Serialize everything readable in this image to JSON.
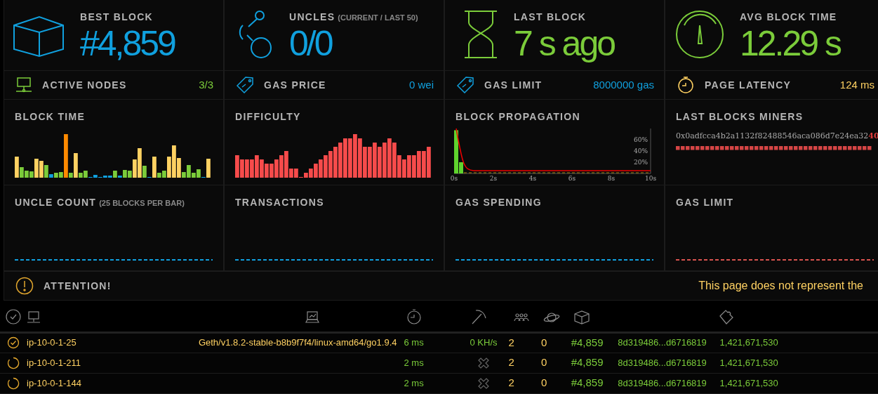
{
  "stats": [
    {
      "kind": "block",
      "label": "BEST BLOCK",
      "value": "#4,859",
      "color": "#10a0de"
    },
    {
      "kind": "uncles",
      "label": "UNCLES",
      "sublabel": "(CURRENT / LAST 50)",
      "value": "0/0",
      "color": "#10a0de"
    },
    {
      "kind": "hourglass",
      "label": "LAST BLOCK",
      "value": "7 s ago",
      "color": "#7bcc3a"
    },
    {
      "kind": "gauge",
      "label": "AVG BLOCK TIME",
      "value": "12.29 s",
      "color": "#7bcc3a"
    }
  ],
  "small_stats": [
    {
      "kind": "nodes",
      "label": "ACTIVE NODES",
      "value": "3/3",
      "color": "#7bcc3a"
    },
    {
      "kind": "tag",
      "label": "GAS PRICE",
      "value": "0 wei",
      "color": "#10a0de"
    },
    {
      "kind": "tag",
      "label": "GAS LIMIT",
      "value": "8000000 gas",
      "color": "#10a0de"
    },
    {
      "kind": "timer",
      "label": "PAGE LATENCY",
      "value": "124 ms",
      "color": "#ffd162"
    }
  ],
  "charts": [
    {
      "kind": "blocktime",
      "title": "BLOCK TIME"
    },
    {
      "kind": "difficulty",
      "title": "DIFFICULTY"
    },
    {
      "kind": "propagation",
      "title": "BLOCK PROPAGATION",
      "chart_data": {
        "type": "bar",
        "x": [
          0.125,
          0.375
        ],
        "series": [
          {
            "color": "#5fd32d",
            "values": [
              77,
              20
            ]
          }
        ],
        "xlim": [
          0,
          10
        ],
        "ylim": [
          0,
          80
        ],
        "xticks": [
          {
            "value": 0,
            "label": "0s"
          },
          {
            "value": 2,
            "label": "2s"
          },
          {
            "value": 4,
            "label": "4s"
          },
          {
            "value": 6,
            "label": "6s"
          },
          {
            "value": 8,
            "label": "8s"
          },
          {
            "value": 10,
            "label": "10s"
          }
        ],
        "yticks": [
          {
            "value": 20,
            "label": "20%"
          },
          {
            "value": 40,
            "label": "40%"
          },
          {
            "value": 60,
            "label": "60%"
          }
        ]
      }
    },
    {
      "kind": "miners",
      "title": "LAST BLOCKS MINERS",
      "miner": "0x0adfcca4b2a1132f82488546aca086d7e24ea32",
      "count": "40"
    },
    {
      "kind": "empty",
      "title": "UNCLE COUNT",
      "subtitle": "(25 BLOCKS PER BAR)",
      "color": "#10a0de"
    },
    {
      "kind": "empty",
      "title": "TRANSACTIONS",
      "color": "#10a0de"
    },
    {
      "kind": "empty",
      "title": "GAS SPENDING",
      "color": "#10a0de"
    },
    {
      "kind": "empty",
      "title": "GAS LIMIT",
      "color": "#d9534f"
    }
  ],
  "attention": {
    "title": "ATTENTION!",
    "message": "This page does not represent the"
  },
  "nodes": [
    {
      "pinned": true,
      "name": "ip-10-0-1-25",
      "client": "Geth/v1.8.2-stable-b8b9f7f4/linux-amd64/go1.9.4",
      "latency": "6 ms",
      "hashrate": "0 KH/s",
      "peers": "2",
      "pending": "0",
      "block": "#4,859",
      "hash": "8d319486...d6716819",
      "difficulty": "1,421,671,530"
    },
    {
      "pinned": false,
      "name": "ip-10-0-1-211",
      "latency": "2 ms",
      "peers": "2",
      "pending": "0",
      "block": "#4,859",
      "hash": "8d319486...d6716819",
      "difficulty": "1,421,671,530"
    },
    {
      "pinned": false,
      "name": "ip-10-0-1-144",
      "latency": "2 ms",
      "peers": "2",
      "pending": "0",
      "block": "#4,859",
      "hash": "8d319486...d6716819",
      "difficulty": "1,421,671,530"
    }
  ]
}
